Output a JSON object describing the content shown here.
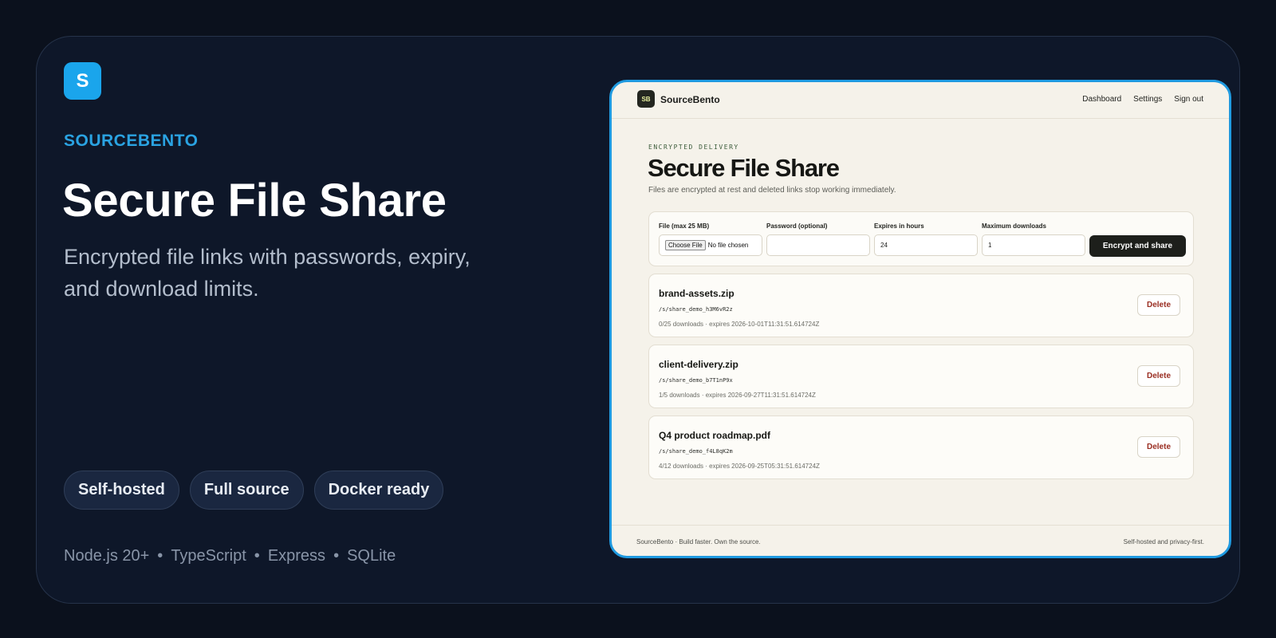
{
  "hero": {
    "logo_letter": "S",
    "brand": "SOURCEBENTO",
    "title": "Secure File Share",
    "subtitle": "Encrypted file links with passwords, expiry, and download limits.",
    "pills": [
      "Self-hosted",
      "Full source",
      "Docker ready"
    ],
    "stack": [
      "Node.js 20+",
      "TypeScript",
      "Express",
      "SQLite"
    ],
    "stack_separator": "•"
  },
  "app": {
    "logo": "SB",
    "name": "SourceBento",
    "nav": [
      "Dashboard",
      "Settings",
      "Sign out"
    ],
    "eyebrow": "ENCRYPTED DELIVERY",
    "title": "Secure File Share",
    "subtitle": "Files are encrypted at rest and deleted links stop working immediately.",
    "form": {
      "file_label": "File (max 25 MB)",
      "choose_file": "Choose File",
      "no_file": "No file chosen",
      "password_label": "Password (optional)",
      "password_value": "",
      "expires_label": "Expires in hours",
      "expires_value": "24",
      "max_downloads_label": "Maximum downloads",
      "max_downloads_value": "1",
      "submit": "Encrypt and share"
    },
    "shares": [
      {
        "name": "brand-assets.zip",
        "link": "/s/share_demo_h3M6vR2z",
        "meta": "0/25 downloads · expires 2026-10-01T11:31:51.614724Z",
        "delete": "Delete"
      },
      {
        "name": "client-delivery.zip",
        "link": "/s/share_demo_b7T1nP9x",
        "meta": "1/5 downloads · expires 2026-09-27T11:31:51.614724Z",
        "delete": "Delete"
      },
      {
        "name": "Q4 product roadmap.pdf",
        "link": "/s/share_demo_f4L8qK2m",
        "meta": "4/12 downloads · expires 2026-09-25T05:31:51.614724Z",
        "delete": "Delete"
      }
    ],
    "footer_left": "SourceBento · Build faster. Own the source.",
    "footer_right": "Self-hosted and privacy-first."
  },
  "colors": {
    "background": "#0b111d",
    "card": "#0e1729",
    "accent": "#1aa5ec",
    "app_background": "#f5f2ea",
    "primary_button": "#1d1f1b",
    "danger_text": "#9a2e22"
  }
}
